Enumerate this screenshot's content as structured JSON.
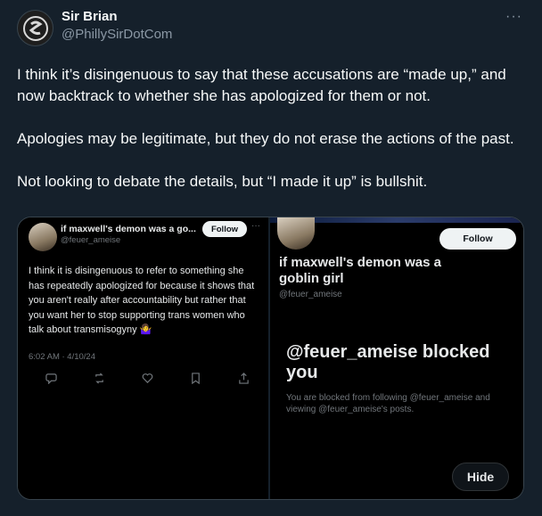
{
  "post": {
    "display_name": "Sir Brian",
    "handle": "@PhillySirDotCom",
    "more": "···",
    "paragraphs": [
      "I think it’s disingenuous to say that these accusations are “made up,” and now backtrack to whether she has apologized for them or not.",
      "Apologies may be legitimate, but they do not erase the actions of the past.",
      "Not looking to debate the details, but “I made it up” is bullshit."
    ]
  },
  "screenshot_left": {
    "name": "if maxwell's demon was a go...",
    "handle": "@feuer_ameise",
    "follow_label": "Follow",
    "dots": "···",
    "body": "I think it is disingenuous to refer to something she has repeatedly apologized for because it shows that you aren't really after accountability but rather that you want her to stop supporting trans women who talk about transmisogyny 🤷‍♀️",
    "timestamp": "6:02 AM · 4/10/24"
  },
  "screenshot_right": {
    "follow_label": "Follow",
    "name": "if maxwell's demon was a goblin girl",
    "handle": "@feuer_ameise",
    "blocked_title": "@feuer_ameise blocked you",
    "blocked_sub": "You are blocked from following @feuer_ameise and viewing @feuer_ameise's posts.",
    "hide_label": "Hide"
  },
  "colors": {
    "background": "#15202b",
    "text": "#f7f9f9",
    "secondary": "#8b98a5"
  }
}
